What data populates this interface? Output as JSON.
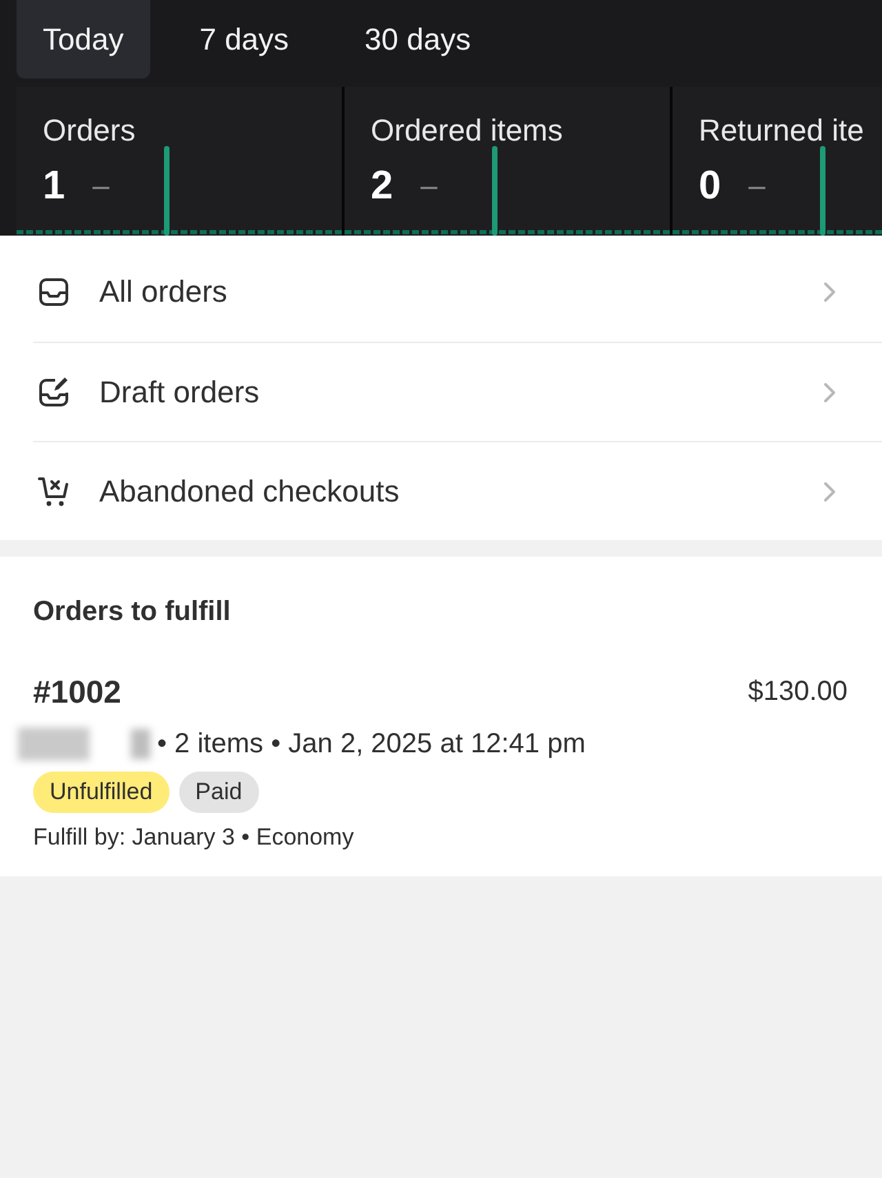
{
  "tabs": [
    {
      "label": "Today",
      "selected": true
    },
    {
      "label": "7 days",
      "selected": false
    },
    {
      "label": "30 days",
      "selected": false
    }
  ],
  "stats": [
    {
      "label": "Orders",
      "value": "1",
      "trend": "–"
    },
    {
      "label": "Ordered items",
      "value": "2",
      "trend": "–"
    },
    {
      "label": "Returned ite",
      "value": "0",
      "trend": "–"
    }
  ],
  "menu": [
    {
      "label": "All orders",
      "kind": "inbox"
    },
    {
      "label": "Draft orders",
      "kind": "draft"
    },
    {
      "label": "Abandoned checkouts",
      "kind": "cart"
    }
  ],
  "fulfill": {
    "title": "Orders to fulfill",
    "orders": [
      {
        "number": "#1002",
        "total": "$130.00",
        "customer_redacted": true,
        "meta": "• 2 items • Jan 2, 2025 at 12:41 pm",
        "badges": [
          {
            "label": "Unfulfilled",
            "color": "#ffeb78"
          },
          {
            "label": "Paid",
            "color": "#e3e3e3"
          }
        ],
        "fulfill_by": "Fulfill by: January 3 • Economy"
      }
    ]
  }
}
